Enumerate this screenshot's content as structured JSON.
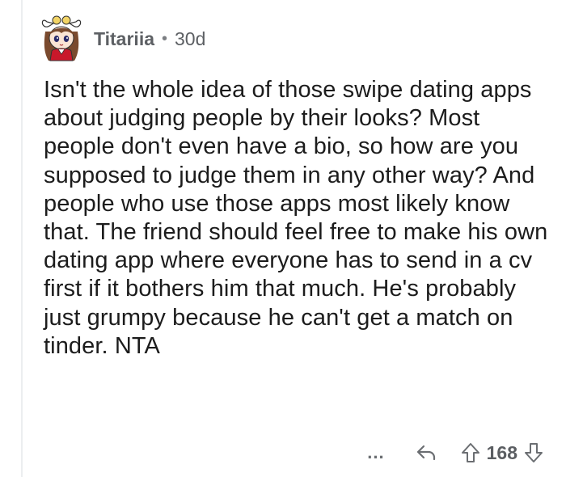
{
  "comment": {
    "author": "Titariia",
    "separator": "•",
    "age": "30d",
    "body": "Isn't the whole idea of those swipe dating apps about judging people by their looks? Most people don't even have a bio, so how are you supposed to judge them in any other way? And people who use those apps most likely know that. The friend should feel free to make his own dating app where everyone has to send in a cv first if it bothers him that much. He's probably just grumpy because he can't get a match on tinder. NTA"
  },
  "actions": {
    "more_label": "...",
    "score": "168",
    "icons": {
      "reply": "reply-arrow-icon",
      "upvote": "upvote-arrow-icon",
      "downvote": "downvote-arrow-icon",
      "more": "more-options-icon"
    }
  },
  "colors": {
    "text": "#1c1c1c",
    "meta": "#5d6064",
    "icon": "#6b6e72",
    "thread_line": "#eceef0"
  }
}
